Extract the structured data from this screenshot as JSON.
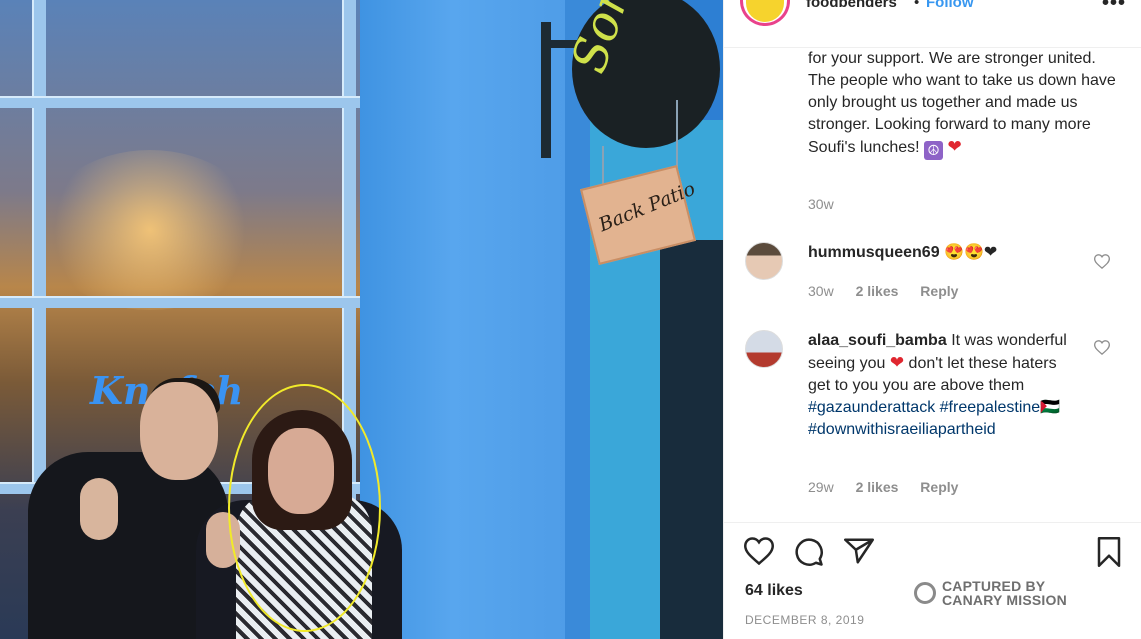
{
  "header": {
    "username": "foodbenders",
    "separator": "•",
    "follow_label": "Follow",
    "more_icon": "more-options-icon"
  },
  "photo": {
    "sign_text": "Songs",
    "patio_sign_text": "Back Patio",
    "window_text": "Knafeh",
    "highlight_color": "#f1ea2a"
  },
  "caption": {
    "text": "for your support. We are stronger united. The people who want to take us down have only brought us together and made us stronger. Looking forward to many more Soufi's lunches!",
    "emoji_peace": "☮",
    "emoji_heart": "❤",
    "time": "30w"
  },
  "comments": [
    {
      "username": "hummusqueen69",
      "emojis": "😍😍❤",
      "time": "30w",
      "likes": "2 likes",
      "reply": "Reply"
    },
    {
      "username": "alaa_soufi_bamba",
      "text_before": "It was wonderful seeing you",
      "heart": "❤",
      "text_after": "don't let these haters get to you you are above them",
      "hashtag1": "#gazaunderattack",
      "hashtag2": "#freepalestine🇵🇸",
      "hashtag3": "#downwithisraeiliapartheid",
      "time": "29w",
      "likes": "2 likes",
      "reply": "Reply"
    }
  ],
  "actions": {
    "likes": "64 likes",
    "date": "DECEMBER 8, 2019"
  },
  "watermark": {
    "line1": "CAPTURED BY",
    "line2": "CANARY MISSION"
  },
  "colors": {
    "accent": "#3897f0",
    "hashtag": "#00376b",
    "muted": "#8e8e8e"
  }
}
